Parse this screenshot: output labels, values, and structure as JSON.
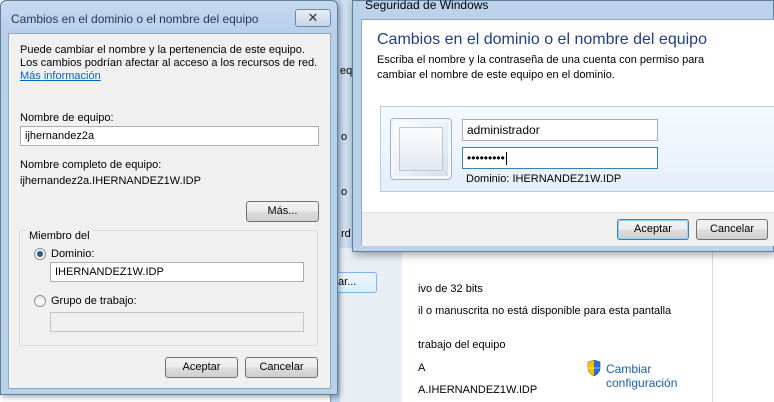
{
  "dialog_main": {
    "title": "Cambios en el dominio o el nombre del equipo",
    "close_glyph": "✕",
    "intro_text": "Puede cambiar el nombre y la pertenencia de este equipo. Los cambios podrían afectar al acceso a los recursos de red.",
    "more_info_link_line1": "Más",
    "more_info_link_line2": "información",
    "computer_name_label": "Nombre de equipo:",
    "computer_name_value": "ijhernandez2a",
    "full_name_label": "Nombre completo de equipo:",
    "full_name_value": "ijhernandez2a.IHERNANDEZ1W.IDP",
    "more_button": "Más...",
    "member_of_label": "Miembro del",
    "domain_radio_label": "Dominio:",
    "domain_value": "IHERNANDEZ1W.IDP",
    "workgroup_radio_label": "Grupo de trabajo:",
    "workgroup_value": "",
    "selected_membership": "domain",
    "ok_button": "Aceptar",
    "cancel_button": "Cancelar"
  },
  "dialog_security": {
    "window_title": "Seguridad de Windows",
    "heading": "Cambios en el dominio o el nombre del equipo",
    "description_line1": "Escriba el nombre y la contraseña de una cuenta con permiso para",
    "description_line2": "cambiar el nombre de este equipo en el dominio.",
    "username_value": "administrador",
    "password_masked": "•••••••••",
    "domain_label": "Dominio: IHERNANDEZ1W.IDP",
    "ok_button": "Aceptar",
    "cancel_button": "Cancelar"
  },
  "background_window": {
    "frag_1": "eque",
    "frag_2": "o",
    "frag_3": "o",
    "frag_4": "rd",
    "button_frag": "ar...",
    "line_32bit": "ivo de 32 bits",
    "line_pen": "il o manuscrita no está disponible para esta pantalla",
    "line_workgroup": "trabajo del equipo",
    "line_a": "A",
    "line_fqdn": "A.IHERNANDEZ1W.IDP",
    "change_settings_line1": "Cambiar",
    "change_settings_line2": "configuración"
  },
  "colors": {
    "link": "#0066cc",
    "heading_blue": "#1e3f8a",
    "frame_blue": "#bcd2ea"
  }
}
